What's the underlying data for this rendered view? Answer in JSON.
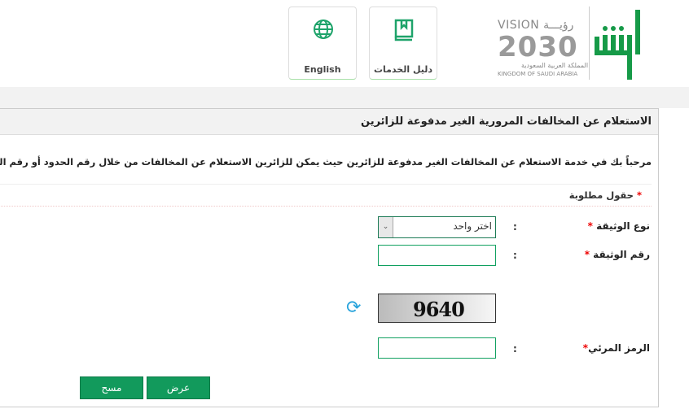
{
  "header": {
    "nav": [
      {
        "label": "English",
        "icon": "globe-icon"
      },
      {
        "label": "دليل الخدمات",
        "icon": "book-icon"
      }
    ],
    "logo": {
      "vision": "VISION رؤيـــة",
      "year": "2030",
      "ksa_ar": "المملكة العربية السعودية",
      "ksa_en": "KINGDOM OF SAUDI ARABIA",
      "brand": "أبشر"
    }
  },
  "panel": {
    "title": "الاستعلام عن المخالفات المرورية الغير مدفوعة للزائرين",
    "intro": "مرحباً بك في خدمة الاستعلام عن المخالفات الغير مدفوعة للزائرين حيث يمكن للزائرين الاستعلام عن المخالفات من خلال رقم الحدود أو رقم الوثيقة",
    "required_note": "حقول مطلوبة",
    "fields": {
      "doc_type": {
        "label": "نوع الوثيقة",
        "value": "اختر واحد"
      },
      "doc_number": {
        "label": "رقم الوثيقة",
        "value": ""
      },
      "captcha_code": {
        "label": "الرمز المرئي",
        "value": ""
      }
    },
    "captcha": "9640",
    "colon": ":",
    "star": "*",
    "buttons": {
      "show": "عرض",
      "clear": "مسح"
    }
  },
  "colors": {
    "accent": "#129a5c",
    "refresh": "#2aa4dc",
    "required": "#e00000"
  }
}
